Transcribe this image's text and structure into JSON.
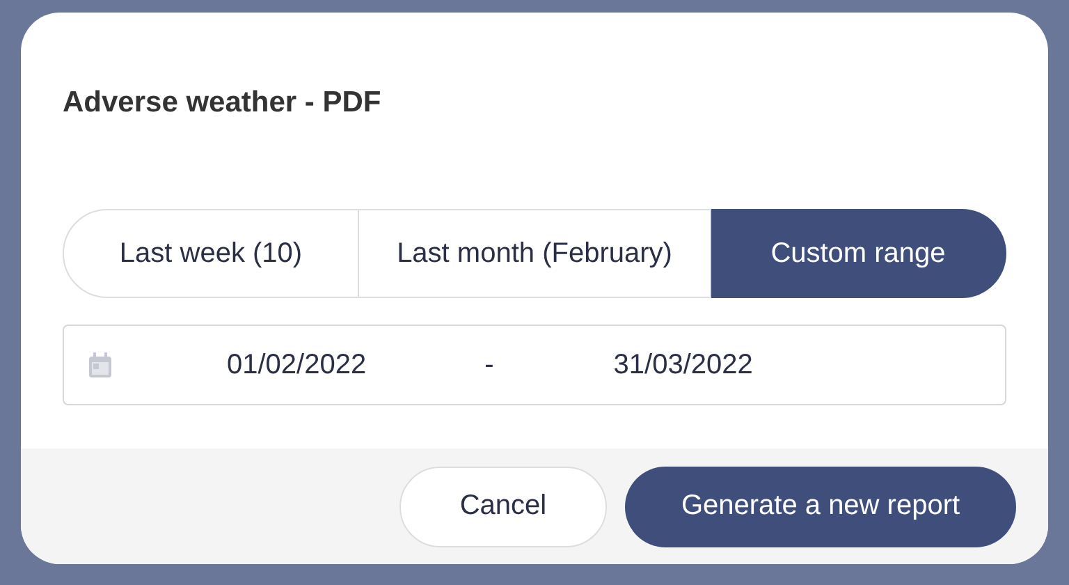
{
  "dialog": {
    "title": "Adverse weather - PDF",
    "range_options": [
      {
        "label": "Last week (10)",
        "selected": false
      },
      {
        "label": "Last month (February)",
        "selected": false
      },
      {
        "label": "Custom range",
        "selected": true
      }
    ],
    "date_range": {
      "start": "01/02/2022",
      "separator": "-",
      "end": "31/03/2022"
    },
    "buttons": [
      {
        "label": "Cancel",
        "kind": "secondary"
      },
      {
        "label": "Generate a new report",
        "kind": "primary"
      }
    ]
  }
}
